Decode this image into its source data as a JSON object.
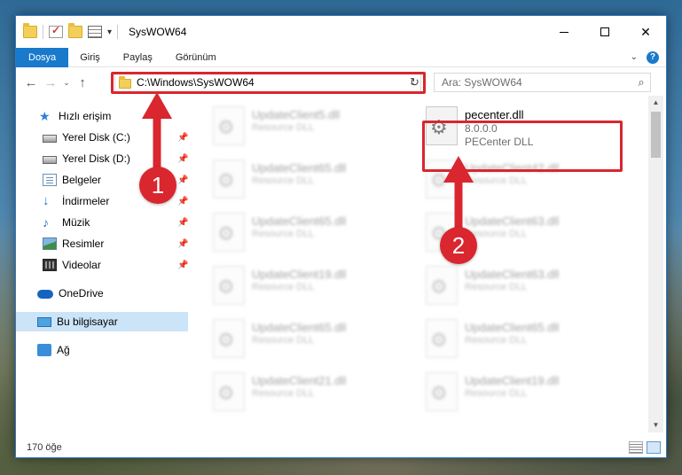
{
  "window": {
    "title": "SysWOW64"
  },
  "ribbon": {
    "tabs": [
      "Dosya",
      "Giriş",
      "Paylaş",
      "Görünüm"
    ]
  },
  "navbar": {
    "address": "C:\\Windows\\SysWOW64",
    "search_placeholder": "Ara: SysWOW64"
  },
  "sidebar": {
    "items": [
      {
        "label": "Hızlı erişim",
        "icon": "star-icon"
      },
      {
        "label": "Yerel Disk (C:)",
        "icon": "disk-icon"
      },
      {
        "label": "Yerel Disk (D:)",
        "icon": "disk-icon"
      },
      {
        "label": "Belgeler",
        "icon": "documents-icon"
      },
      {
        "label": "İndirmeler",
        "icon": "download-icon"
      },
      {
        "label": "Müzik",
        "icon": "music-icon"
      },
      {
        "label": "Resimler",
        "icon": "pictures-icon"
      },
      {
        "label": "Videolar",
        "icon": "videos-icon"
      },
      {
        "label": "OneDrive",
        "icon": "cloud-icon"
      },
      {
        "label": "Bu bilgisayar",
        "icon": "computer-icon"
      },
      {
        "label": "Ağ",
        "icon": "network-icon"
      }
    ]
  },
  "files": {
    "left_column": [
      {
        "name": "UpdateClient5.dll",
        "type": "Resource DLL"
      },
      {
        "name": "UpdateClient65.dll",
        "type": "Resource DLL"
      },
      {
        "name": "UpdateClient65.dll",
        "type": "Resource DLL"
      },
      {
        "name": "UpdateClient19.dll",
        "type": "Resource DLL"
      },
      {
        "name": "UpdateClient65.dll",
        "type": "Resource DLL"
      },
      {
        "name": "UpdateClient21.dll",
        "type": "Resource DLL"
      }
    ],
    "featured": {
      "name": "pecenter.dll",
      "version": "8.0.0.0",
      "description": "PECenter DLL"
    },
    "right_column": [
      {
        "name": "UpdateClient42.dll",
        "type": "Resource DLL"
      },
      {
        "name": "UpdateClient63.dll",
        "type": "Resource DLL"
      },
      {
        "name": "UpdateClient63.dll",
        "type": "Resource DLL"
      },
      {
        "name": "UpdateClient65.dll",
        "type": "Resource DLL"
      },
      {
        "name": "UpdateClient19.dll",
        "type": "Resource DLL"
      }
    ]
  },
  "status": {
    "item_count": "170 öğe"
  },
  "annotations": {
    "step1": "1",
    "step2": "2",
    "color": "#d9262f"
  }
}
